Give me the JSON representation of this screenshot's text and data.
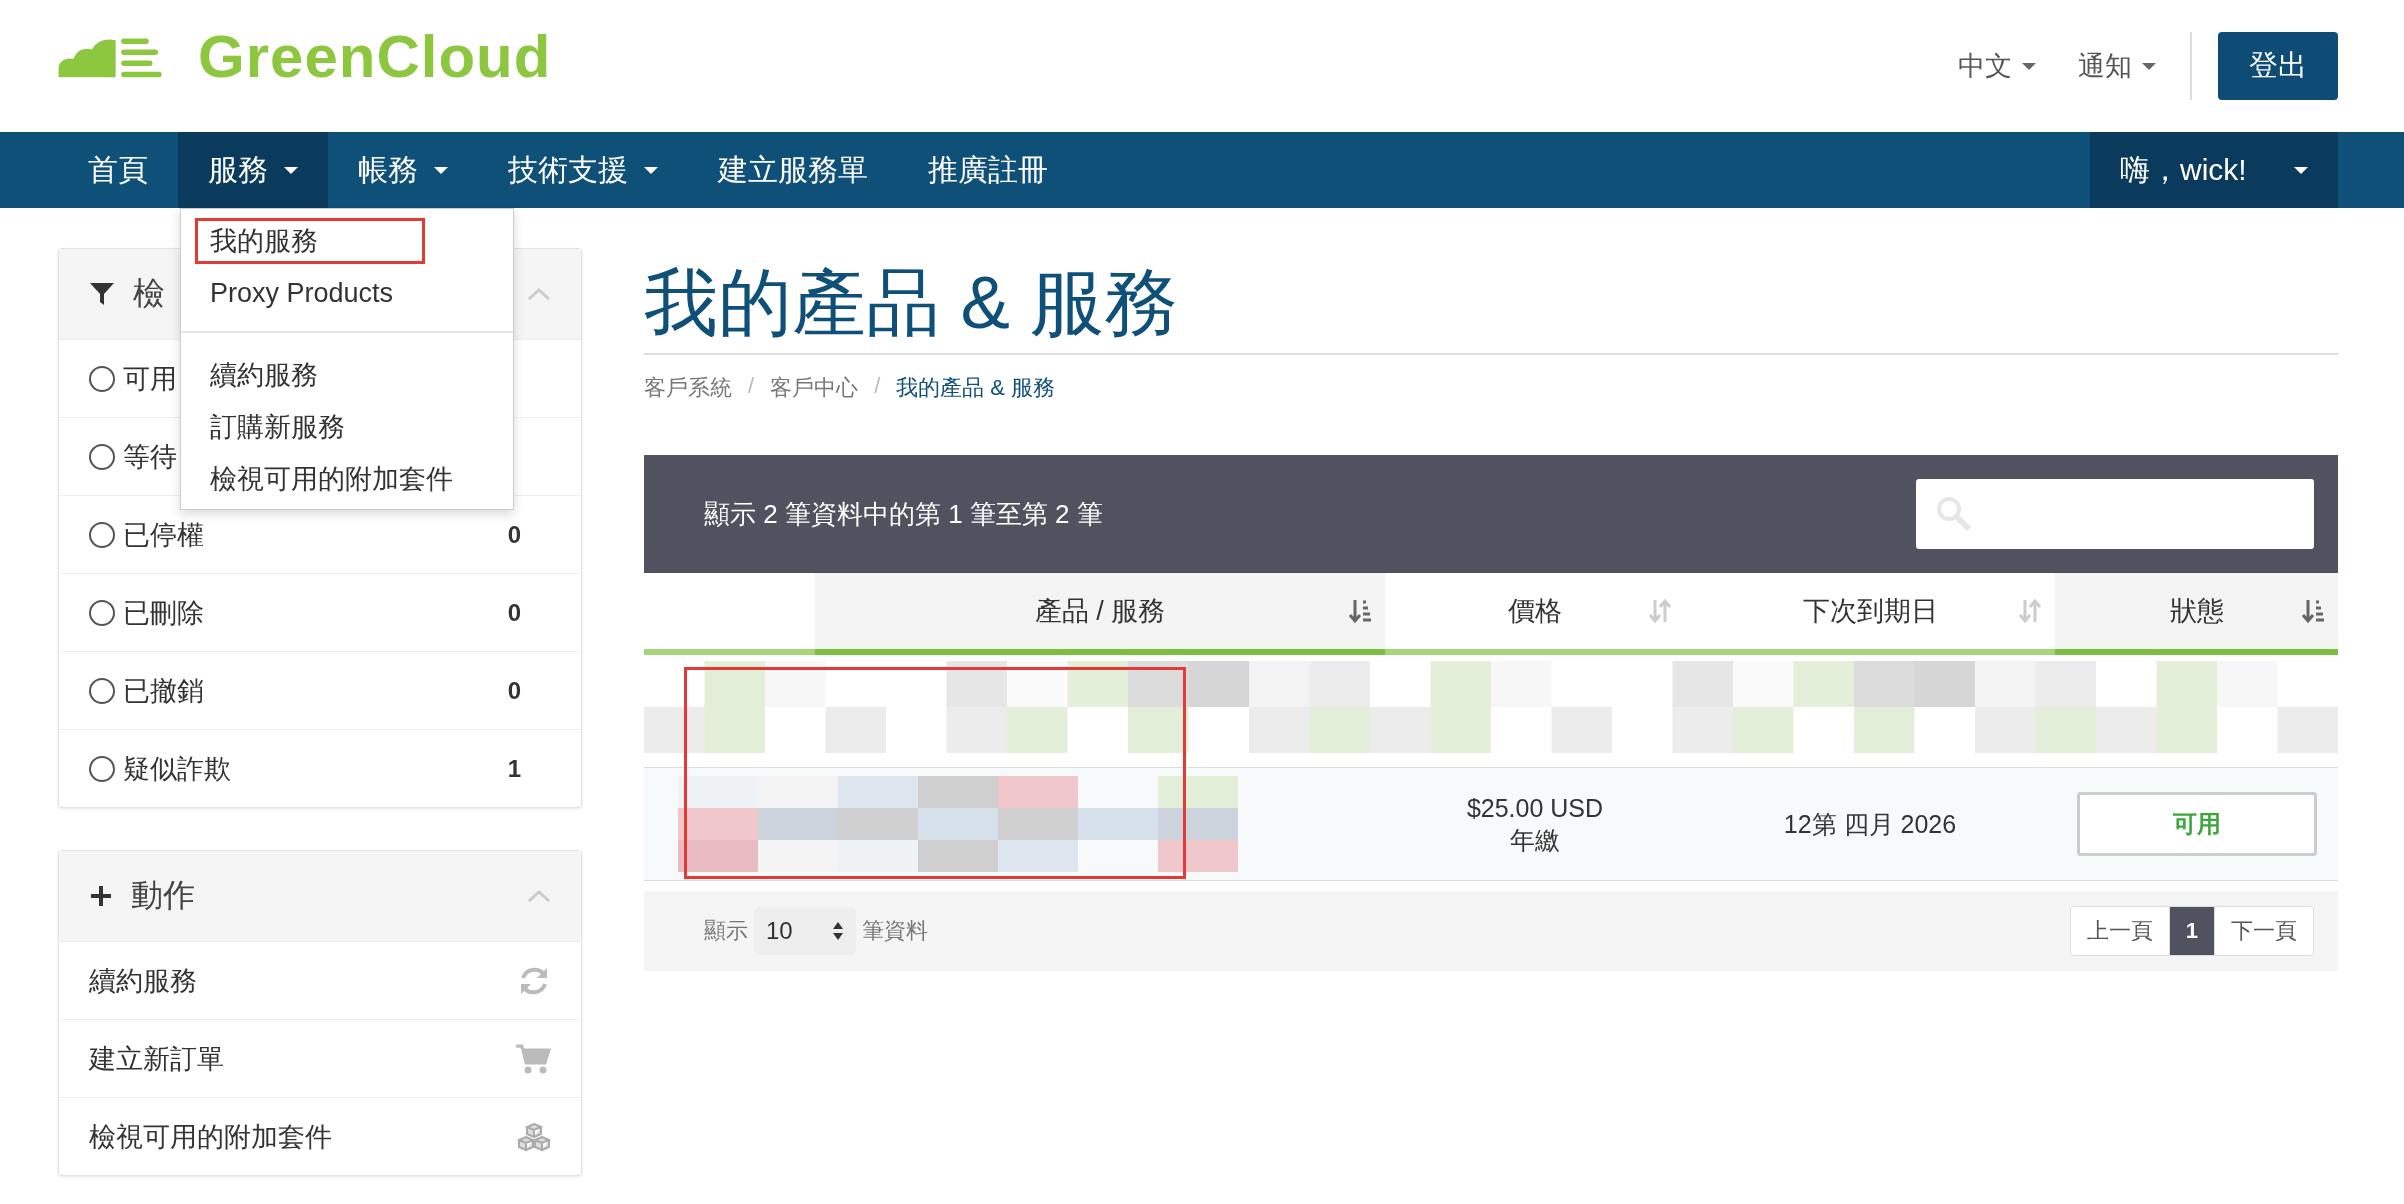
{
  "logo": {
    "text": "GreenCloud"
  },
  "top_links": [
    {
      "label": "中文"
    },
    {
      "label": "通知"
    }
  ],
  "logout": "登出",
  "nav": [
    {
      "label": "首頁",
      "dropdown": false,
      "selected": false
    },
    {
      "label": "服務",
      "dropdown": true,
      "selected": true
    },
    {
      "label": "帳務",
      "dropdown": true,
      "selected": false
    },
    {
      "label": "技術支援",
      "dropdown": true,
      "selected": false
    },
    {
      "label": "建立服務單",
      "dropdown": false,
      "selected": false
    },
    {
      "label": "推廣註冊",
      "dropdown": false,
      "selected": false
    }
  ],
  "user_menu": "嗨，wick!",
  "dropdown": {
    "groups": [
      [
        {
          "label": "我的服務",
          "highlighted": true
        },
        {
          "label": "Proxy Products",
          "highlighted": false
        }
      ],
      [
        {
          "label": "續約服務",
          "highlighted": false
        },
        {
          "label": "訂購新服務",
          "highlighted": false
        },
        {
          "label": "檢視可用的附加套件",
          "highlighted": false
        }
      ]
    ]
  },
  "filter_panel": {
    "title": "檢",
    "items": [
      {
        "label": "可用",
        "selected": false
      },
      {
        "label": "等待",
        "selected": false
      },
      {
        "label": "已停權",
        "count": "0",
        "selected": false
      },
      {
        "label": "已刪除",
        "count": "0",
        "selected": false
      },
      {
        "label": "已撤銷",
        "count": "0",
        "selected": false
      },
      {
        "label": "疑似詐欺",
        "count": "1",
        "selected": false
      }
    ]
  },
  "actions_panel": {
    "title": "動作",
    "items": [
      {
        "label": "續約服務"
      },
      {
        "label": "建立新訂單"
      },
      {
        "label": "檢視可用的附加套件"
      }
    ]
  },
  "page_title": "我的產品 & 服務",
  "breadcrumb": [
    {
      "label": "客戶系統",
      "selected": false
    },
    {
      "separator": "/",
      "label": "客戶中心",
      "selected": false
    },
    {
      "separator": "/",
      "label": "我的產品 & 服務",
      "selected": true
    }
  ],
  "table": {
    "info": "顯示 2 筆資料中的第 1 筆至第 2 筆",
    "columns": [
      {
        "label": "產品 / 服務",
        "sorted": true
      },
      {
        "label": "價格",
        "sorted": false
      },
      {
        "label": "下次到期日",
        "sorted": false
      },
      {
        "label": "狀態",
        "sorted": true
      }
    ],
    "rows": [
      {
        "kind": "redacted"
      },
      {
        "kind": "partial",
        "price": "$25.00 USD",
        "cycle": "年繳",
        "due": "12第 四月 2026",
        "status": "可用"
      }
    ],
    "length_label_before": "顯示",
    "length_value": "10",
    "length_label_after": "筆資料",
    "pagination": [
      {
        "label": "上一頁",
        "selected": false
      },
      {
        "label": "1",
        "selected": true
      },
      {
        "label": "下一頁",
        "selected": false
      }
    ]
  }
}
